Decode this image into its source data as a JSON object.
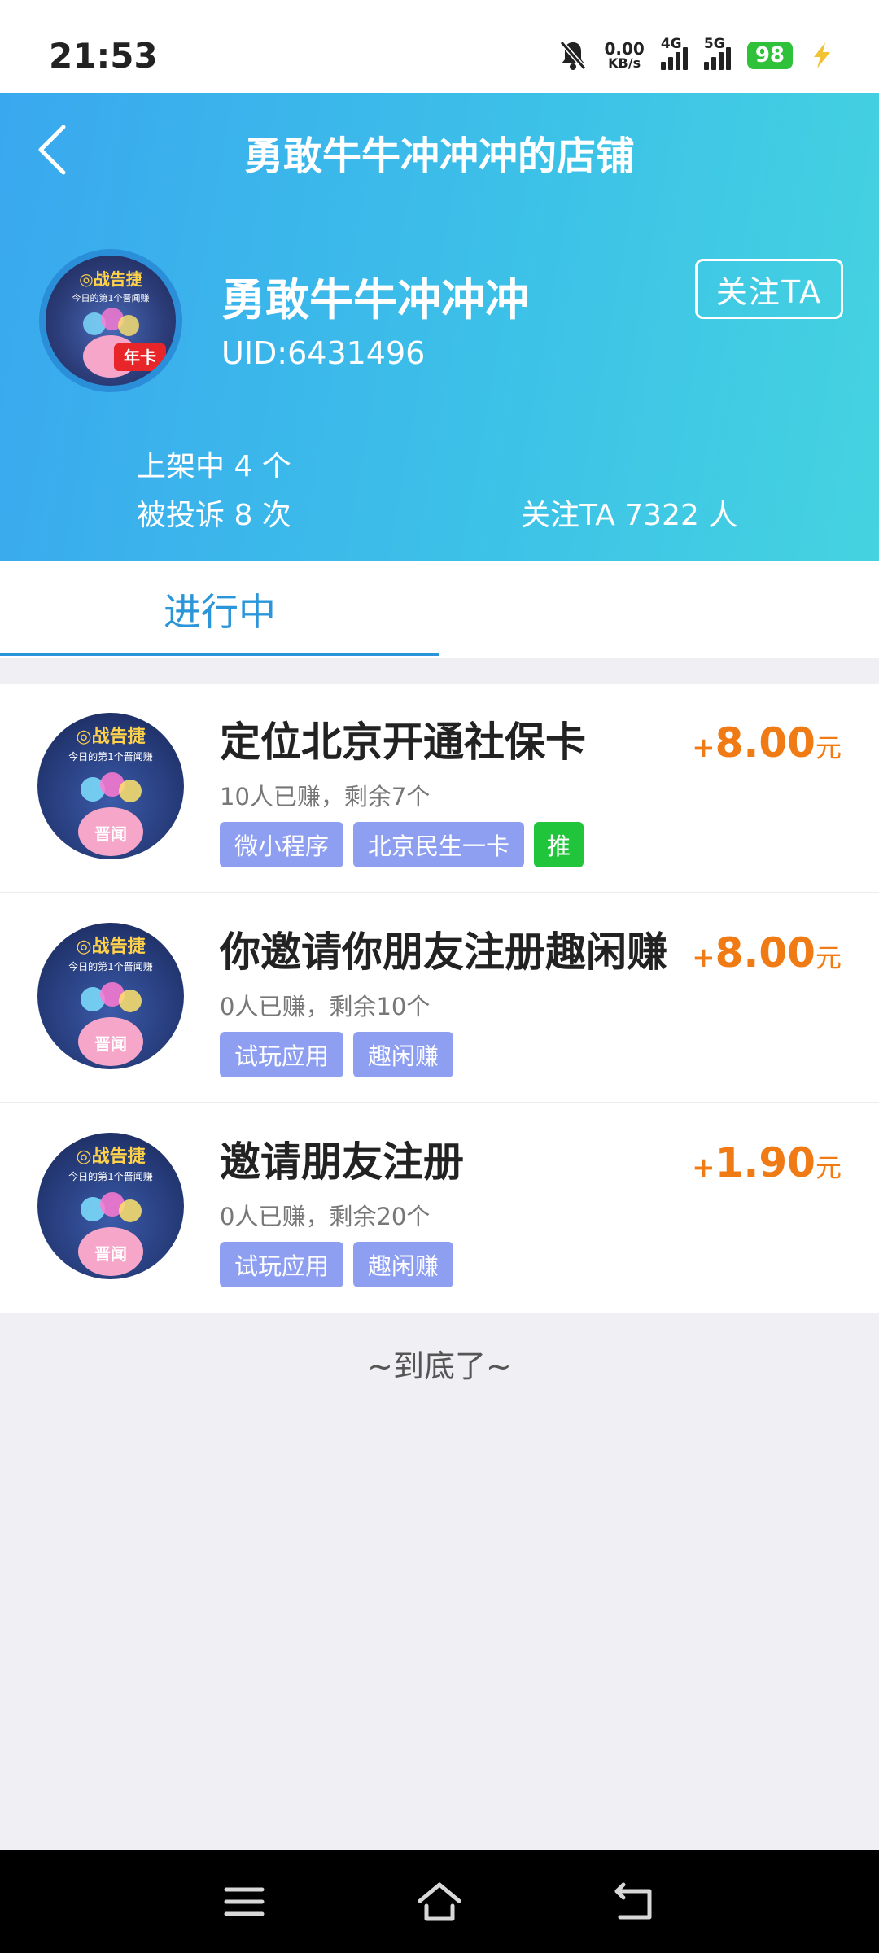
{
  "status_bar": {
    "time": "21:53",
    "net_speed_value": "0.00",
    "net_speed_unit": "KB/s",
    "signal1_label": "4G",
    "signal2_label": "5G",
    "battery": "98"
  },
  "header": {
    "title": "勇敢牛牛冲冲冲的店铺",
    "shop_name": "勇敢牛牛冲冲冲",
    "uid": "UID:6431496",
    "follow_label": "关注TA",
    "listed": "上架中 4 个",
    "complaints": "被投诉 8 次",
    "followers": "关注TA 7322 人"
  },
  "tabs": {
    "active": "进行中"
  },
  "tasks": [
    {
      "title": "定位北京开通社保卡",
      "meta": "10人已赚，剩余7个",
      "tags": [
        "微小程序",
        "北京民生一卡"
      ],
      "hot_tag": "推",
      "price_plus": "+",
      "price": "8.00",
      "unit": "元"
    },
    {
      "title": "你邀请你朋友注册趣闲赚",
      "meta": "0人已赚，剩余10个",
      "tags": [
        "试玩应用",
        "趣闲赚"
      ],
      "price_plus": "+",
      "price": "8.00",
      "unit": "元"
    },
    {
      "title": "邀请朋友注册",
      "meta": "0人已赚，剩余20个",
      "tags": [
        "试玩应用",
        "趣闲赚"
      ],
      "price_plus": "+",
      "price": "1.90",
      "unit": "元"
    }
  ],
  "footer_text": "~到底了~",
  "colors": {
    "header_start": "#3aa8ef",
    "header_end": "#45d3e0",
    "accent": "#2a95d8",
    "price": "#f07a14",
    "tag": "#8e9ff2",
    "hot_tag": "#21c53c"
  }
}
